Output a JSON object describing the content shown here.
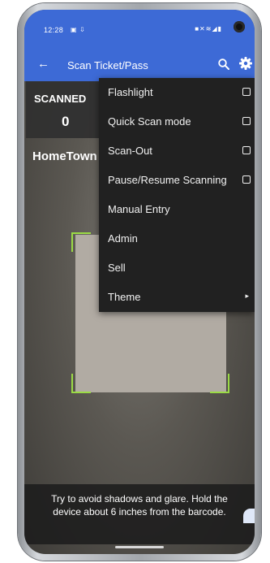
{
  "status_bar": {
    "time": "12:28",
    "left_icons": [
      "message-icon",
      "download-icon"
    ],
    "right_icons": [
      "lock-icon",
      "mute-icon",
      "wifi-icon",
      "signal-icon",
      "battery-icon"
    ]
  },
  "app_bar": {
    "title": "Scan Ticket/Pass",
    "back_icon": "arrow-left-icon",
    "search_icon": "search-icon",
    "settings_icon": "gear-icon",
    "color": "#3d6ad6"
  },
  "stats": {
    "scanned_label": "SCANNED",
    "scanned_value": "0",
    "location": "HomeTown"
  },
  "menu": {
    "items": [
      {
        "label": "Flashlight",
        "control": "checkbox",
        "checked": false
      },
      {
        "label": "Quick Scan mode",
        "control": "checkbox",
        "checked": false
      },
      {
        "label": "Scan-Out",
        "control": "checkbox",
        "checked": false
      },
      {
        "label": "Pause/Resume Scanning",
        "control": "checkbox",
        "checked": false
      },
      {
        "label": "Manual Entry",
        "control": "none"
      },
      {
        "label": "Admin",
        "control": "none"
      },
      {
        "label": "Sell",
        "control": "none"
      },
      {
        "label": "Theme",
        "control": "submenu"
      }
    ]
  },
  "scanner": {
    "hint": "Try to avoid shadows and glare. Hold the device about 6 inches from the barcode.",
    "frame_color": "#9bdb45"
  }
}
